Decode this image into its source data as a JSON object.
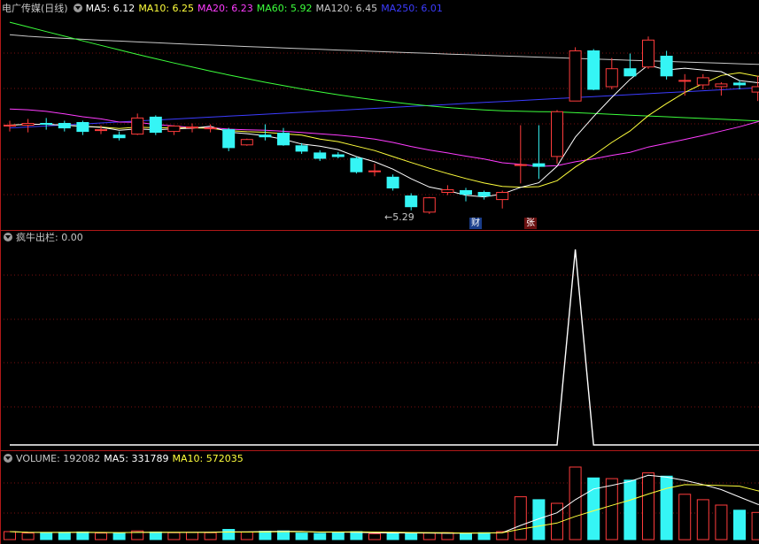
{
  "colors": {
    "up": "#ff3c3c",
    "down": "#35f5f5",
    "ma5": "#ffffff",
    "ma10": "#ffff3c",
    "ma20": "#ff3cff",
    "ma60": "#3cff3c",
    "ma120": "#c8c8c8",
    "ma250": "#3c3cff",
    "grid": "#7a1010",
    "axis": "#b01818"
  },
  "price_header": {
    "title": "电广传媒(日线)",
    "ma5": "MA5: 6.12",
    "ma10": "MA10: 6.25",
    "ma20": "MA20: 6.23",
    "ma60": "MA60: 5.92",
    "ma120": "MA120: 6.45",
    "ma250": "MA250: 6.01"
  },
  "indicator_header": {
    "title": "疯牛出栏",
    "value": ": 0.00"
  },
  "volume_header": {
    "title": "VOLUME: 192082",
    "ma5": "MA5: 331789",
    "ma10": "MA10: 572035"
  },
  "annotations": {
    "low_label": "←5.29",
    "badge_cai": "财",
    "badge_zhang": "张"
  },
  "chart_data": [
    {
      "type": "candlestick",
      "name": "price",
      "ohlc": [
        [
          6.55,
          6.6,
          6.48,
          6.55
        ],
        [
          6.55,
          6.62,
          6.47,
          6.57
        ],
        [
          6.57,
          6.63,
          6.5,
          6.56
        ],
        [
          6.57,
          6.6,
          6.48,
          6.52
        ],
        [
          6.58,
          6.6,
          6.44,
          6.48
        ],
        [
          6.5,
          6.55,
          6.45,
          6.5
        ],
        [
          6.44,
          6.48,
          6.38,
          6.41
        ],
        [
          6.45,
          6.68,
          6.44,
          6.63
        ],
        [
          6.64,
          6.66,
          6.44,
          6.47
        ],
        [
          6.48,
          6.55,
          6.44,
          6.54
        ],
        [
          6.52,
          6.57,
          6.47,
          6.53
        ],
        [
          6.52,
          6.56,
          6.47,
          6.52
        ],
        [
          6.5,
          6.52,
          6.26,
          6.3
        ],
        [
          6.33,
          6.4,
          6.32,
          6.39
        ],
        [
          6.44,
          6.56,
          6.38,
          6.42
        ],
        [
          6.46,
          6.52,
          6.32,
          6.33
        ],
        [
          6.32,
          6.35,
          6.23,
          6.26
        ],
        [
          6.24,
          6.27,
          6.15,
          6.18
        ],
        [
          6.22,
          6.25,
          6.18,
          6.2
        ],
        [
          6.18,
          6.2,
          6.01,
          6.03
        ],
        [
          6.04,
          6.12,
          5.98,
          6.04
        ],
        [
          5.97,
          6.0,
          5.82,
          5.85
        ],
        [
          5.76,
          5.79,
          5.6,
          5.64
        ],
        [
          5.58,
          5.75,
          5.56,
          5.74
        ],
        [
          5.8,
          5.88,
          5.77,
          5.83
        ],
        [
          5.82,
          5.85,
          5.7,
          5.78
        ],
        [
          5.8,
          5.82,
          5.72,
          5.76
        ],
        [
          5.72,
          5.82,
          5.62,
          5.8
        ],
        [
          6.1,
          6.55,
          5.9,
          6.11
        ],
        [
          6.12,
          6.55,
          5.95,
          6.09
        ],
        [
          6.2,
          6.72,
          6.12,
          6.7
        ],
        [
          6.82,
          7.42,
          6.82,
          7.38
        ],
        [
          7.38,
          7.4,
          6.94,
          6.95
        ],
        [
          6.98,
          7.3,
          6.95,
          7.18
        ],
        [
          7.18,
          7.35,
          7.12,
          7.1
        ],
        [
          7.2,
          7.54,
          7.18,
          7.5
        ],
        [
          7.32,
          7.38,
          7.06,
          7.1
        ],
        [
          7.04,
          7.12,
          6.88,
          7.05
        ],
        [
          7.0,
          7.12,
          6.95,
          7.08
        ],
        [
          6.98,
          7.03,
          6.88,
          7.01
        ],
        [
          7.02,
          7.05,
          6.95,
          7.0
        ],
        [
          6.92,
          7.1,
          6.82,
          6.98
        ],
        [
          6.94,
          7.12,
          6.84,
          7.15
        ],
        [
          7.02,
          7.25,
          6.98,
          7.18
        ],
        [
          7.15,
          7.22,
          7.05,
          7.14
        ]
      ]
    },
    {
      "type": "line",
      "name": "疯牛出栏",
      "peak_index": 31,
      "peak_value": 1,
      "values_default": 0
    },
    {
      "type": "bar",
      "name": "VOLUME",
      "values": [
        22,
        18,
        19,
        20,
        21,
        18,
        17,
        24,
        21,
        19,
        20,
        19,
        28,
        21,
        23,
        24,
        18,
        17,
        20,
        22,
        16,
        17,
        17,
        18,
        19,
        17,
        19,
        22,
        118,
        110,
        100,
        200,
        170,
        168,
        164,
        184,
        175,
        125,
        110,
        95,
        81,
        75,
        73,
        120,
        95
      ]
    }
  ]
}
